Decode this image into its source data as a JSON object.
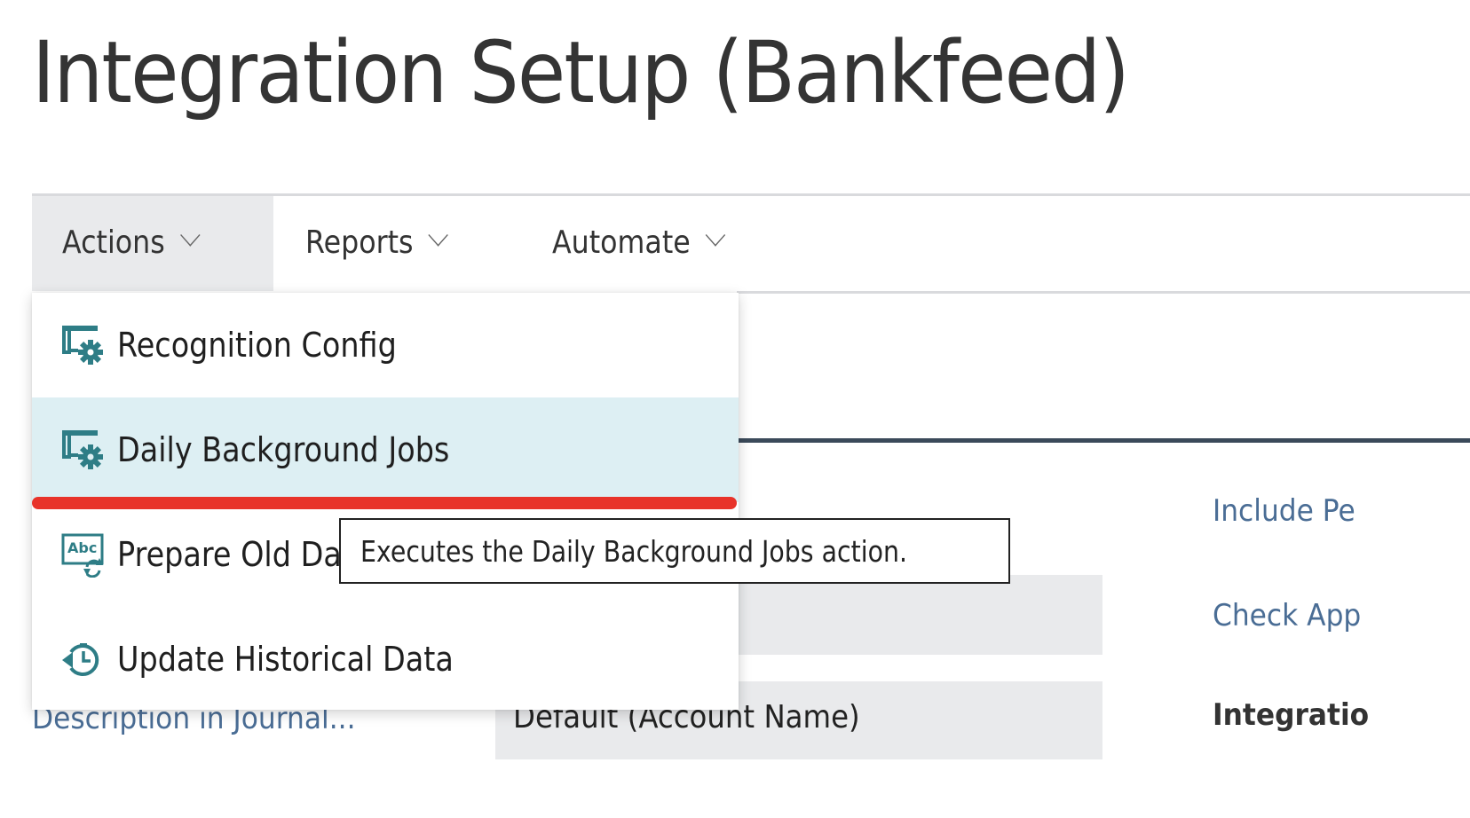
{
  "page": {
    "title": "Integration Setup (Bankfeed)"
  },
  "action_bar": {
    "tabs": [
      {
        "label": "Actions",
        "active": true
      },
      {
        "label": "Reports",
        "active": false
      },
      {
        "label": "Automate",
        "active": false
      }
    ]
  },
  "actions_menu": {
    "items": [
      {
        "label": "Recognition Config",
        "icon": "setup-gear-icon"
      },
      {
        "label": "Daily Background Jobs",
        "icon": "setup-gear-icon",
        "highlighted": true
      },
      {
        "label": "Prepare Old Data",
        "icon": "text-refresh-icon"
      },
      {
        "label": "Update Historical Data",
        "icon": "history-clock-icon"
      }
    ]
  },
  "tooltip": {
    "text": "Executes the Daily Background Jobs action."
  },
  "form": {
    "fields_left": [
      {
        "label": "Description in Journal...",
        "value": "Default (Account Name)"
      }
    ],
    "fields_right": [
      {
        "label": "Include Pe"
      },
      {
        "label": "Check App"
      }
    ],
    "group_caption": "Integratio"
  },
  "colors": {
    "accent_icon": "#2e7d86",
    "hover_row": "#ddeff3",
    "highlight_underline": "#e8332a",
    "field_label": "#4a6d95"
  }
}
